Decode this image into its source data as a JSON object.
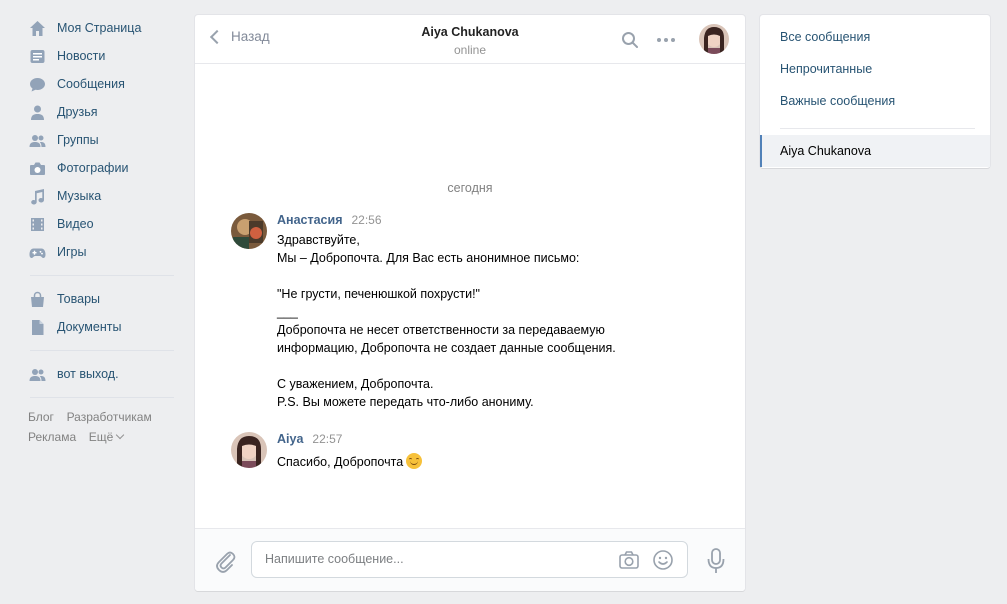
{
  "left_nav": {
    "items": [
      {
        "label": "Моя Страница",
        "icon": "home-icon"
      },
      {
        "label": "Новости",
        "icon": "news-icon"
      },
      {
        "label": "Сообщения",
        "icon": "messages-icon"
      },
      {
        "label": "Друзья",
        "icon": "friends-icon"
      },
      {
        "label": "Группы",
        "icon": "groups-icon"
      },
      {
        "label": "Фотографии",
        "icon": "camera-icon"
      },
      {
        "label": "Музыка",
        "icon": "music-icon"
      },
      {
        "label": "Видео",
        "icon": "video-icon"
      },
      {
        "label": "Игры",
        "icon": "gamepad-icon"
      }
    ],
    "items2": [
      {
        "label": "Товары",
        "icon": "bag-icon"
      },
      {
        "label": "Документы",
        "icon": "document-icon"
      }
    ],
    "items3": [
      {
        "label": "вот выход.",
        "icon": "group-icon"
      }
    ],
    "footer": {
      "blog": "Блог",
      "developers": "Разработчикам",
      "ads": "Реклама",
      "more": "Ещё"
    }
  },
  "chat": {
    "back_label": "Назад",
    "title": "Aiya Chukanova",
    "status": "online",
    "day_label": "сегодня",
    "messages": [
      {
        "author": "Анастасия",
        "time": "22:56",
        "lines": [
          "Здравствуйте,",
          "Мы – Добропочта. Для Вас есть анонимное письмо:",
          "",
          "\"Не грусти, печенюшкой похрусти!\"",
          "___",
          "Добропочта не несет ответственности за передаваемую",
          "информацию, Добропочта не создает данные сообщения.",
          "",
          "С уважением, Добропочта.",
          "P.S. Вы можете передать что-либо анониму."
        ]
      },
      {
        "author": "Aiya",
        "time": "22:57",
        "lines": [
          "Спасибо, Добропочта"
        ],
        "emoji": "smiling-face-emoji"
      }
    ],
    "composer": {
      "placeholder": "Напишите сообщение..."
    }
  },
  "right_panel": {
    "filters": [
      "Все сообщения",
      "Непрочитанные",
      "Важные сообщения"
    ],
    "active_dialog": "Aiya Chukanova"
  },
  "colors": {
    "link": "#285473",
    "author": "#42648b",
    "accent": "#5181b8",
    "bg": "#edeef0"
  }
}
